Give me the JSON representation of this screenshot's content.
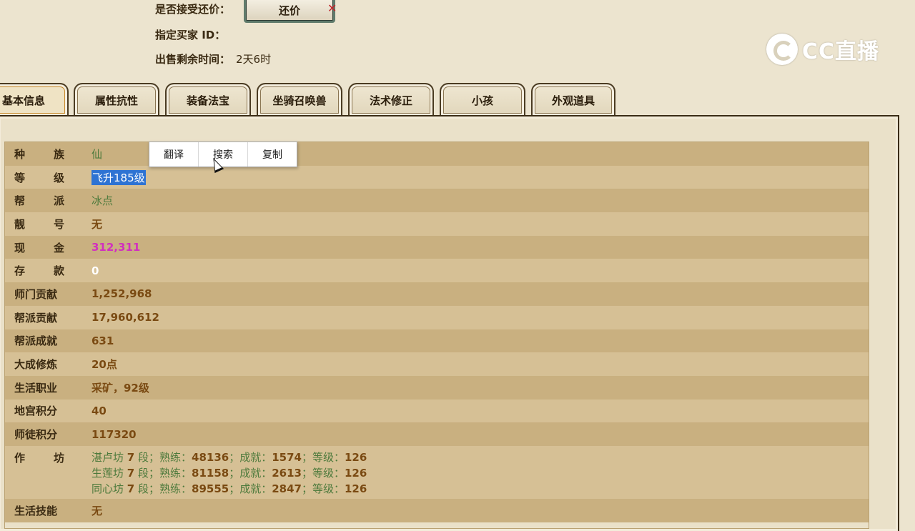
{
  "top": {
    "counter_offer_label": "是否接受还价：",
    "counter_offer_button": "还价",
    "buyer_id_label": "指定买家 ID：",
    "remaining_time_label": "出售剩余时间：",
    "remaining_time_value": "2天6时"
  },
  "logo": {
    "text": "CC直播"
  },
  "tabs": [
    "基本信息",
    "属性抗性",
    "装备法宝",
    "坐骑召唤兽",
    "法术修正",
    "小孩",
    "外观道具"
  ],
  "context_menu": {
    "items": [
      "翻译",
      "搜索",
      "复制"
    ]
  },
  "rows": [
    {
      "label_a": "种",
      "label_b": "族",
      "value": "仙"
    },
    {
      "label_a": "等",
      "label_b": "级",
      "value": "飞升185级"
    },
    {
      "label_a": "帮",
      "label_b": "派",
      "value": "冰点"
    },
    {
      "label_a": "靓",
      "label_b": "号",
      "value": "无"
    },
    {
      "label_a": "现",
      "label_b": "金",
      "value": "312,311"
    },
    {
      "label_a": "存",
      "label_b": "款",
      "value": "0"
    },
    {
      "label": "师门贡献",
      "value": "1,252,968"
    },
    {
      "label": "帮派贡献",
      "value": "17,960,612"
    },
    {
      "label": "帮派成就",
      "value": "631"
    },
    {
      "label": "大成修炼",
      "value": "20点"
    },
    {
      "label": "生活职业",
      "value": "采矿，92级"
    },
    {
      "label": "地宫积分",
      "value": "40"
    },
    {
      "label": "师徒积分",
      "value": "117320"
    }
  ],
  "workshop": {
    "label_a": "作",
    "label_b": "坊",
    "lines": [
      {
        "name": "湛卢坊",
        "duan": "7",
        "duan_unit": "段；熟练：",
        "skill": "48136",
        "ach_label": "；成就：",
        "ach": "1574",
        "lvl_label": "；等级：",
        "lvl": "126"
      },
      {
        "name": "生莲坊",
        "duan": "7",
        "duan_unit": "段；熟练：",
        "skill": "81158",
        "ach_label": "；成就：",
        "ach": "2613",
        "lvl_label": "；等级：",
        "lvl": "126"
      },
      {
        "name": "同心坊",
        "duan": "7",
        "duan_unit": "段；熟练：",
        "skill": "89555",
        "ach_label": "；成就：",
        "ach": "2847",
        "lvl_label": "；等级：",
        "lvl": "126"
      }
    ]
  },
  "last_row": {
    "label": "生活技能",
    "value": "无"
  },
  "colors": {
    "selection": "#2e73d3",
    "cash": "#d22fbf",
    "green_text": "#4d7a3c",
    "value_brown": "#7a4a12"
  }
}
